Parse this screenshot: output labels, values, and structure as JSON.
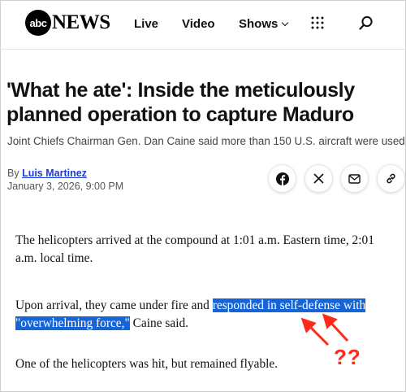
{
  "brand": {
    "logo_circle": "abc",
    "logo_word": "NEWS"
  },
  "nav": {
    "live": "Live",
    "video": "Video",
    "shows": "Shows"
  },
  "icons": {
    "menu": "grid-dots-icon",
    "search": "search-icon",
    "facebook": "facebook-icon",
    "x": "x-icon",
    "mail": "mail-icon",
    "link": "link-icon"
  },
  "article": {
    "headline": "'What he ate': Inside the meticulously planned operation to capture Maduro",
    "subhead": "Joint Chiefs Chairman Gen. Dan Caine said more than 150 U.S. aircraft were used.",
    "by_prefix": "By ",
    "author": "Luis Martinez",
    "date": "January 3, 2026, 9:00 PM",
    "p1": "The helicopters arrived at the compound at 1:01 a.m. Eastern time, 2:01 a.m. local time.",
    "p2_before": "Upon arrival, they came under fire and ",
    "p2_highlight": "responded in self-defense with \"overwhelming force,\"",
    "p2_after": " Caine said.",
    "p3": "One of the helicopters was hit, but remained flyable."
  },
  "annotation": {
    "text": "??",
    "color": "#ff2a1a"
  },
  "colors": {
    "highlight": "#1565d8",
    "author_link": "#1e3bd8"
  }
}
